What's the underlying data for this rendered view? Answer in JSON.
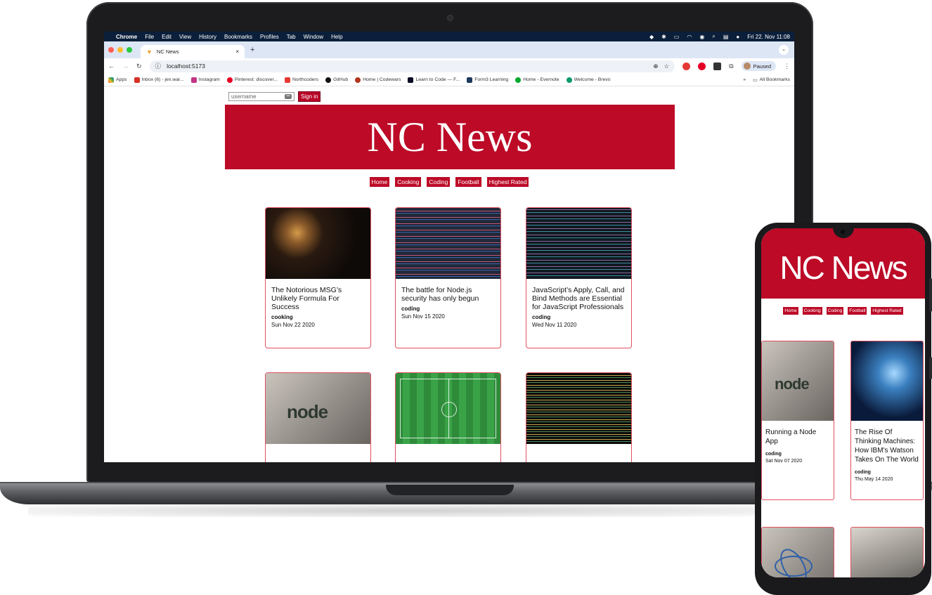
{
  "browser": {
    "menubar": {
      "app": "Chrome",
      "items": [
        "File",
        "Edit",
        "View",
        "History",
        "Bookmarks",
        "Profiles",
        "Tab",
        "Window",
        "Help"
      ],
      "clock": "Fri 22. Nov 11:08"
    },
    "tab": {
      "title": "NC News",
      "close": "×",
      "new": "+"
    },
    "url": "localhost:5173",
    "profile": "Paused",
    "bookmarks": [
      {
        "label": "Apps",
        "color": "#e53935"
      },
      {
        "label": "Inbox (6) - jen.war...",
        "color": "#d93025"
      },
      {
        "label": "Instagram",
        "color": "#c13584"
      },
      {
        "label": "Pinterest: discover...",
        "color": "#e60023"
      },
      {
        "label": "Northcoders",
        "color": "#e53935"
      },
      {
        "label": "GitHub",
        "color": "#111111"
      },
      {
        "label": "Home | Codewars",
        "color": "#b1361e"
      },
      {
        "label": "Learn to Code — F...",
        "color": "#0a0a23"
      },
      {
        "label": "Form3 Learning",
        "color": "#1f3a5f"
      },
      {
        "label": "Home - Evernote",
        "color": "#00a82d"
      },
      {
        "label": "Welcome - Brevo",
        "color": "#0b996e"
      }
    ],
    "all_bookmarks": "All Bookmarks",
    "more": "»"
  },
  "site": {
    "username_placeholder": "username",
    "signin_label": "Sign in",
    "title": "NC News",
    "nav": [
      "Home",
      "Cooking",
      "Coding",
      "Football",
      "Highest Rated"
    ],
    "accent": "#bc0a27",
    "articles": [
      {
        "title": "The Notorious MSG’s Unlikely Formula For Success",
        "topic": "cooking",
        "date": "Sun Nov 22 2020"
      },
      {
        "title": "The battle for Node.js security has only begun",
        "topic": "coding",
        "date": "Sun Nov 15 2020"
      },
      {
        "title": "JavaScript’s Apply, Call, and Bind Methods are Essential for JavaScript Professionals",
        "topic": "coding",
        "date": "Wed Nov 11 2020"
      }
    ],
    "second_row_images": [
      "node-logo-image",
      "football-pitch-image",
      "code-screen-image"
    ]
  },
  "phone": {
    "title": "NC News",
    "nav": [
      "Home",
      "Cooking",
      "Coding",
      "Football",
      "Highest Rated"
    ],
    "articles": [
      {
        "title": "Running a Node App",
        "topic": "coding",
        "date": "Sat Nov 07 2020"
      },
      {
        "title": "The Rise Of Thinking Machines: How IBM's Watson Takes On The World",
        "topic": "coding",
        "date": "Thu May 14 2020"
      }
    ]
  }
}
